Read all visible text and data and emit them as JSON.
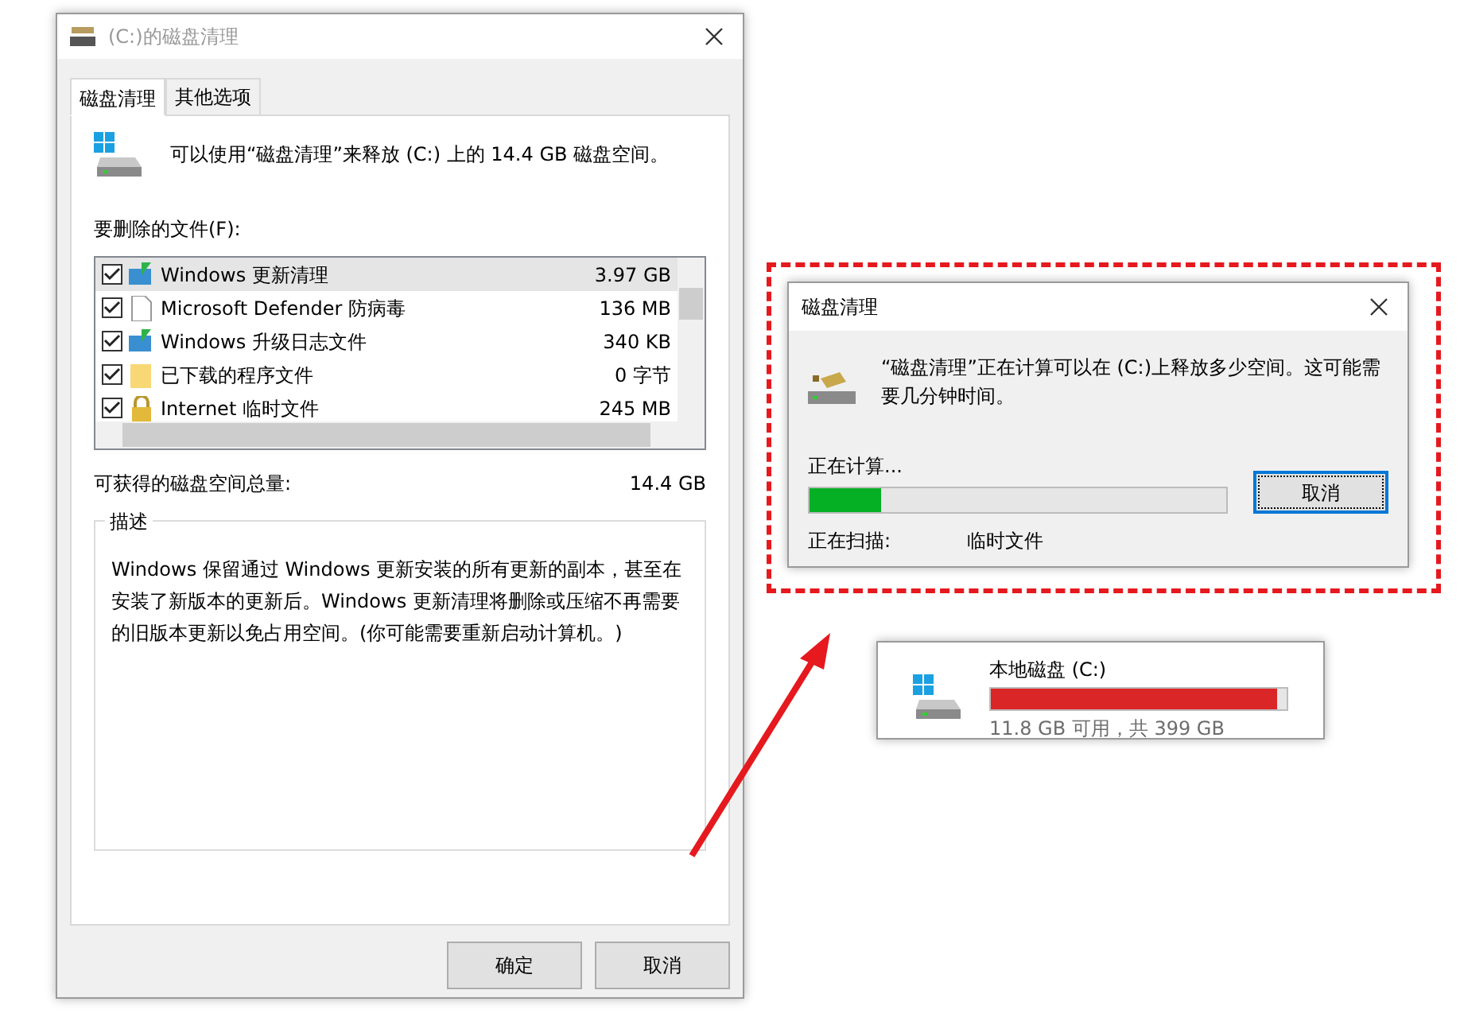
{
  "main_window": {
    "title": "(C:)的磁盘清理",
    "tabs": [
      {
        "label": "磁盘清理",
        "selected": true
      },
      {
        "label": "其他选项",
        "selected": false
      }
    ],
    "intro": "可以使用“磁盘清理”来释放 (C:) 上的 14.4 GB 磁盘空间。",
    "files_label": "要删除的文件(F):",
    "files": [
      {
        "kind": "update",
        "name": "Windows 更新清理",
        "size": "3.97 GB",
        "checked": true,
        "selected": true
      },
      {
        "kind": "file",
        "name": "Microsoft Defender 防病毒",
        "size": "136 MB",
        "checked": true,
        "selected": false
      },
      {
        "kind": "update",
        "name": "Windows 升级日志文件",
        "size": "340 KB",
        "checked": true,
        "selected": false
      },
      {
        "kind": "folder",
        "name": "已下载的程序文件",
        "size": "0 字节",
        "checked": true,
        "selected": false
      },
      {
        "kind": "lock",
        "name": "Internet 临时文件",
        "size": "245 MB",
        "checked": true,
        "selected": false
      }
    ],
    "total_label": "可获得的磁盘空间总量:",
    "total_value": "14.4 GB",
    "description": {
      "title": "描述",
      "text": "Windows 保留通过 Windows 更新安装的所有更新的副本，甚至在安装了新版本的更新后。Windows 更新清理将删除或压缩不再需要的旧版本更新以免占用空间。(你可能需要重新启动计算机。)"
    },
    "buttons": [
      "确定",
      "取消"
    ]
  },
  "progress_dialog": {
    "title": "磁盘清理",
    "message": "“磁盘清理”正在计算可以在 (C:)上释放多少空间。这可能需要几分钟时间。",
    "status": "正在计算...",
    "progress": {
      "level": 0.17
    },
    "scanning_label": "正在扫描:",
    "scanning_value": "临时文件",
    "button": "取消"
  },
  "drive": {
    "name": "本地磁盘 (C:)",
    "level": 0.97,
    "usage": "11.8 GB 可用，共 399 GB"
  }
}
